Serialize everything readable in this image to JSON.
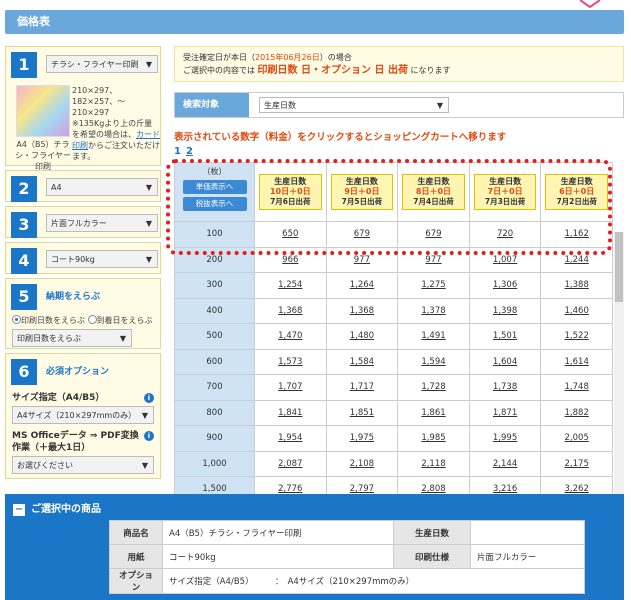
{
  "header": {
    "title": "価格表"
  },
  "steps": {
    "s1": {
      "num": "1",
      "select": "チラシ・フライヤー印刷",
      "desc": "210×297、182×257、～210×297",
      "note": "※135Kgより上の斤量を希望の場合は、",
      "link": "カード印刷",
      "note2": "からご注文いただけます。",
      "name": "A4（B5）チラシ・フライヤー印刷"
    },
    "s2": {
      "num": "2",
      "select": "A4"
    },
    "s3": {
      "num": "3",
      "select": "片面フルカラー"
    },
    "s4": {
      "num": "4",
      "select": "コート90kg"
    },
    "s5": {
      "num": "5",
      "title": "納期をえらぶ",
      "radio1": "印刷日数をえらぶ",
      "radio2": "到着日をえらぶ",
      "select": "印刷日数をえらぶ"
    },
    "s6": {
      "num": "6",
      "title": "必須オプション",
      "size_label": "サイズ指定（A4/B5）",
      "size_select": "A4サイズ（210×297mmのみ）",
      "ms_label": "MS Officeデータ ⇒ PDF変換作業（＋最大1日）",
      "ms_select": "お選びください"
    }
  },
  "notice": {
    "line1_a": "受注確定日が本日（",
    "date": "2015年06月26日",
    "line1_b": "）の場合",
    "line2_a": "ご選択中の内容では ",
    "days": "印刷日数 日",
    "plus": "・",
    "option": "オプション 日 出荷",
    "line2_b": " になります"
  },
  "search": {
    "label": "検索対象",
    "select": "生産日数"
  },
  "click_msg": "表示されている数字（料金）をクリックするとショッピングカートへ移ります",
  "pager": {
    "current": "1",
    "other": "2"
  },
  "table": {
    "qty_header": "（枚）",
    "btn_tax_excl": "単価表示へ",
    "btn_tax_incl": "税抜表示へ",
    "columns": [
      {
        "d1": "生産日数",
        "d2": "10日＋0日",
        "d3": "7月6日出荷"
      },
      {
        "d1": "生産日数",
        "d2": "9日＋0日",
        "d3": "7月5日出荷"
      },
      {
        "d1": "生産日数",
        "d2": "8日＋0日",
        "d3": "7月4日出荷"
      },
      {
        "d1": "生産日数",
        "d2": "7日＋0日",
        "d3": "7月3日出荷"
      },
      {
        "d1": "生産日数",
        "d2": "6日＋0日",
        "d3": "7月2日出荷"
      }
    ],
    "rows": [
      {
        "qty": "100",
        "vals": [
          "650",
          "679",
          "679",
          "720",
          "1,162"
        ]
      },
      {
        "qty": "200",
        "vals": [
          "966",
          "977",
          "977",
          "1,007",
          "1,244"
        ]
      },
      {
        "qty": "300",
        "vals": [
          "1,254",
          "1,264",
          "1,275",
          "1,306",
          "1,388"
        ]
      },
      {
        "qty": "400",
        "vals": [
          "1,368",
          "1,368",
          "1,378",
          "1,398",
          "1,460"
        ]
      },
      {
        "qty": "500",
        "vals": [
          "1,470",
          "1,480",
          "1,491",
          "1,501",
          "1,522"
        ]
      },
      {
        "qty": "600",
        "vals": [
          "1,573",
          "1,584",
          "1,594",
          "1,604",
          "1,614"
        ]
      },
      {
        "qty": "700",
        "vals": [
          "1,707",
          "1,717",
          "1,728",
          "1,738",
          "1,748"
        ]
      },
      {
        "qty": "800",
        "vals": [
          "1,841",
          "1,851",
          "1,861",
          "1,871",
          "1,882"
        ]
      },
      {
        "qty": "900",
        "vals": [
          "1,954",
          "1,975",
          "1,985",
          "1,995",
          "2,005"
        ]
      },
      {
        "qty": "1,000",
        "vals": [
          "2,087",
          "2,108",
          "2,118",
          "2,144",
          "2,175"
        ]
      },
      {
        "qty": "1,500",
        "vals": [
          "2,776",
          "2,797",
          "2,808",
          "3,216",
          "3,262"
        ]
      }
    ]
  },
  "selected": {
    "title": "ご選択中の商品",
    "product_k": "商品名",
    "product_v": "A4（B5）チラシ・フライヤー印刷",
    "days_k": "生産日数",
    "days_v": "",
    "paper_k": "用紙",
    "paper_v": "コート90kg",
    "spec_k": "印刷仕様",
    "spec_v": "片面フルカラー",
    "option_k": "オプション",
    "option_v": "サイズ指定（A4/B5）　　　：　A4サイズ（210×297mmのみ）"
  },
  "colors": {
    "accent": "#1b76c8",
    "header": "#6aa8dc",
    "highlight_red": "#e04a10"
  }
}
